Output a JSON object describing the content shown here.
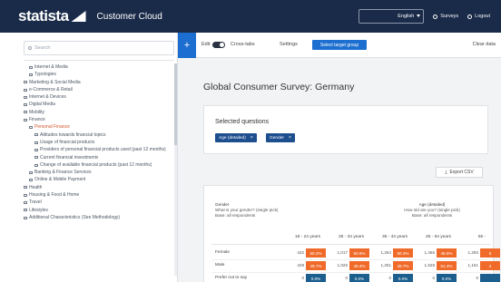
{
  "header": {
    "logo_text": "statista",
    "product": "Customer Cloud",
    "language": "English",
    "surveys": "Surveys",
    "logout": "Logout"
  },
  "sidebar": {
    "search_placeholder": "Search",
    "tree": [
      {
        "label": "Internet & Media",
        "level": 2
      },
      {
        "label": "Typologies",
        "level": 2
      },
      {
        "label": "Marketing & Social Media",
        "level": 1
      },
      {
        "label": "e-Commerce & Retail",
        "level": 1
      },
      {
        "label": "Internet & Devices",
        "level": 1
      },
      {
        "label": "Digital Media",
        "level": 1
      },
      {
        "label": "Mobility",
        "level": 1
      },
      {
        "label": "Finance",
        "level": 1
      },
      {
        "label": "Personal Finance",
        "level": 2,
        "highlight": true
      },
      {
        "label": "Attitudes towards financial topics",
        "level": 3
      },
      {
        "label": "Usage of financial products",
        "level": 3
      },
      {
        "label": "Providers of personal financial products used (past 12 months)",
        "level": 3
      },
      {
        "label": "Current financial investments",
        "level": 3
      },
      {
        "label": "Change of available financial products (past 12 months)",
        "level": 3
      },
      {
        "label": "Banking & Finance Services",
        "level": 2
      },
      {
        "label": "Online & Mobile Payment",
        "level": 2
      },
      {
        "label": "Health",
        "level": 1
      },
      {
        "label": "Housing & Food & Home",
        "level": 1
      },
      {
        "label": "Travel",
        "level": 1
      },
      {
        "label": "Lifestyles",
        "level": 1
      },
      {
        "label": "Additional Characteristics (See Methodology)",
        "level": 1
      }
    ]
  },
  "toolbar": {
    "plus": "+",
    "edit_label": "Edit",
    "crosstab_label": "Cross-tabs",
    "settings_label": "Settings",
    "select_target_label": "Select target group",
    "clear_label": "Clear data"
  },
  "main": {
    "page_title": "Global Consumer Survey: Germany",
    "selected_questions_title": "Selected questions",
    "tags": [
      "Age (detailed)",
      "Gender"
    ],
    "export_label": "Export CSV"
  },
  "table": {
    "left_head": {
      "title": "Gender",
      "question": "What is your gender? (single pick)",
      "base": "Base: all respondents"
    },
    "right_head": {
      "title": "Age (detailed)",
      "question": "How old are you? (single pick)",
      "base": "Base: all respondents"
    },
    "columns": [
      "18 - 24 years",
      "25 - 34 years",
      "35 - 44 years",
      "45 - 54 years",
      "55 -"
    ],
    "rows": [
      {
        "label": "Female",
        "cells": [
          {
            "n": "432",
            "p": "50.2%"
          },
          {
            "n": "1,017",
            "p": "50.6%"
          },
          {
            "n": "1,264",
            "p": "50.3%"
          },
          {
            "n": "1,455",
            "p": "48.5%"
          },
          {
            "n": "1,293",
            "p": "5"
          }
        ]
      },
      {
        "label": "Male",
        "cells": [
          {
            "n": "429",
            "p": "49.7%"
          },
          {
            "n": "1,026",
            "p": "49.4%"
          },
          {
            "n": "1,251",
            "p": "49.7%"
          },
          {
            "n": "1,528",
            "p": "51.4%"
          },
          {
            "n": "1,161",
            "p": "4"
          }
        ]
      },
      {
        "label": "Prefer not to say",
        "cells": [
          {
            "n": "0",
            "p": "0.0%"
          },
          {
            "n": "0",
            "p": "0.0%"
          },
          {
            "n": "0",
            "p": "0.0%"
          },
          {
            "n": "0",
            "p": "0.0%"
          },
          {
            "n": "0",
            "p": ""
          }
        ]
      }
    ],
    "colors": {
      "orange": "#f06a2a",
      "teal": "#2c7db3",
      "dark": "#1c5f8e"
    }
  }
}
